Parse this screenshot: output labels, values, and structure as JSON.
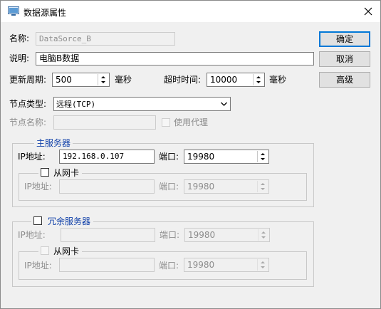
{
  "window": {
    "title": "数据源属性",
    "icon": "window-icon",
    "close_icon": "close-icon"
  },
  "fields": {
    "name_label": "名称:",
    "name_value": "DataSorce_B",
    "desc_label": "说明:",
    "desc_value": "电脑B数据",
    "refresh_label": "更新周期:",
    "refresh_value": "500",
    "refresh_unit": "毫秒",
    "timeout_label": "超时时间:",
    "timeout_value": "10000",
    "timeout_unit": "毫秒",
    "node_type_label": "节点类型:",
    "node_type_value": "远程(TCP)",
    "node_name_label": "节点名称:",
    "node_name_value": "",
    "proxy_label": "使用代理"
  },
  "buttons": {
    "ok": "确定",
    "cancel": "取消",
    "advanced": "高级"
  },
  "primary": {
    "legend": "主服务器",
    "ip_label": "IP地址:",
    "ip_value": "192.168.0.107",
    "port_label": "端口:",
    "port_value": "19980",
    "backup_nic": {
      "legend": "从网卡",
      "ip_label": "IP地址:",
      "ip_value": "",
      "port_label": "端口:",
      "port_value": "19980"
    }
  },
  "redundant": {
    "legend": "冗余服务器",
    "ip_label": "IP地址:",
    "ip_value": "",
    "port_label": "端口:",
    "port_value": "19980",
    "backup_nic": {
      "legend": "从网卡",
      "ip_label": "IP地址:",
      "ip_value": "",
      "port_label": "端口:",
      "port_value": "19980"
    }
  },
  "colors": {
    "accent": "#0078d7",
    "group_legend": "#0f3fa8",
    "disabled_text": "#8d8d8d"
  }
}
